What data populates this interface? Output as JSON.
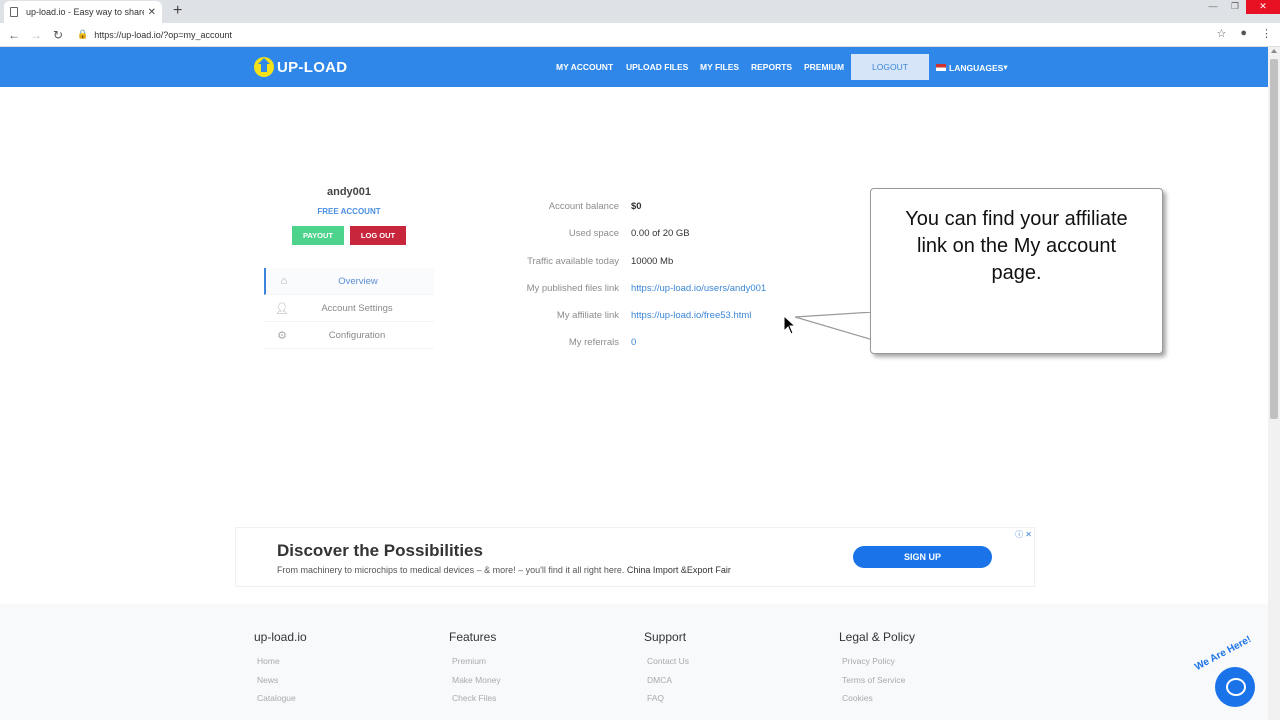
{
  "browser": {
    "tab_title": "up-load.io - Easy way to share yo",
    "url": "https://up-load.io/?op=my_account"
  },
  "header": {
    "logo_text": "UP-LOAD",
    "nav": [
      "MY ACCOUNT",
      "UPLOAD FILES",
      "MY FILES",
      "REPORTS",
      "PREMIUM"
    ],
    "logout": "LOGOUT",
    "languages": "LANGUAGES"
  },
  "profile": {
    "username": "andy001",
    "account_type": "FREE ACCOUNT",
    "payout": "PAYOUT",
    "logout": "LOG OUT"
  },
  "sidemenu": [
    "Overview",
    "Account Settings",
    "Configuration"
  ],
  "info": [
    {
      "label": "Account balance",
      "value": "$0"
    },
    {
      "label": "Used space",
      "value": "0.00 of 20 GB"
    },
    {
      "label": "Traffic available today",
      "value": "10000 Mb"
    },
    {
      "label": "My published files link",
      "value": "https://up-load.io/users/andy001"
    },
    {
      "label": "My affiliate link",
      "value": "https://up-load.io/free53.html"
    },
    {
      "label": "My referrals",
      "value": "0"
    }
  ],
  "callout": "You can find your affiliate link on the My account page.",
  "ad": {
    "title": "Discover the Possibilities",
    "text": "From machinery to microchips to medical devices – & more! – you'll find it all right here.",
    "sponsor": "China Import &Export Fair",
    "button": "SIGN UP"
  },
  "footer": {
    "columns": [
      {
        "title": "up-load.io",
        "links": [
          "Home",
          "News",
          "Catalogue"
        ]
      },
      {
        "title": "Features",
        "links": [
          "Premium",
          "Make Money",
          "Check Files"
        ]
      },
      {
        "title": "Support",
        "links": [
          "Contact Us",
          "DMCA",
          "FAQ"
        ]
      },
      {
        "title": "Legal & Policy",
        "links": [
          "Privacy Policy",
          "Terms of Service",
          "Cookies"
        ]
      }
    ]
  },
  "chat_badge": "We Are Here!",
  "colors": {
    "brand": "#2e87e9",
    "payout": "#4ed38c",
    "logout": "#c8263c",
    "link": "#3b86d8"
  }
}
